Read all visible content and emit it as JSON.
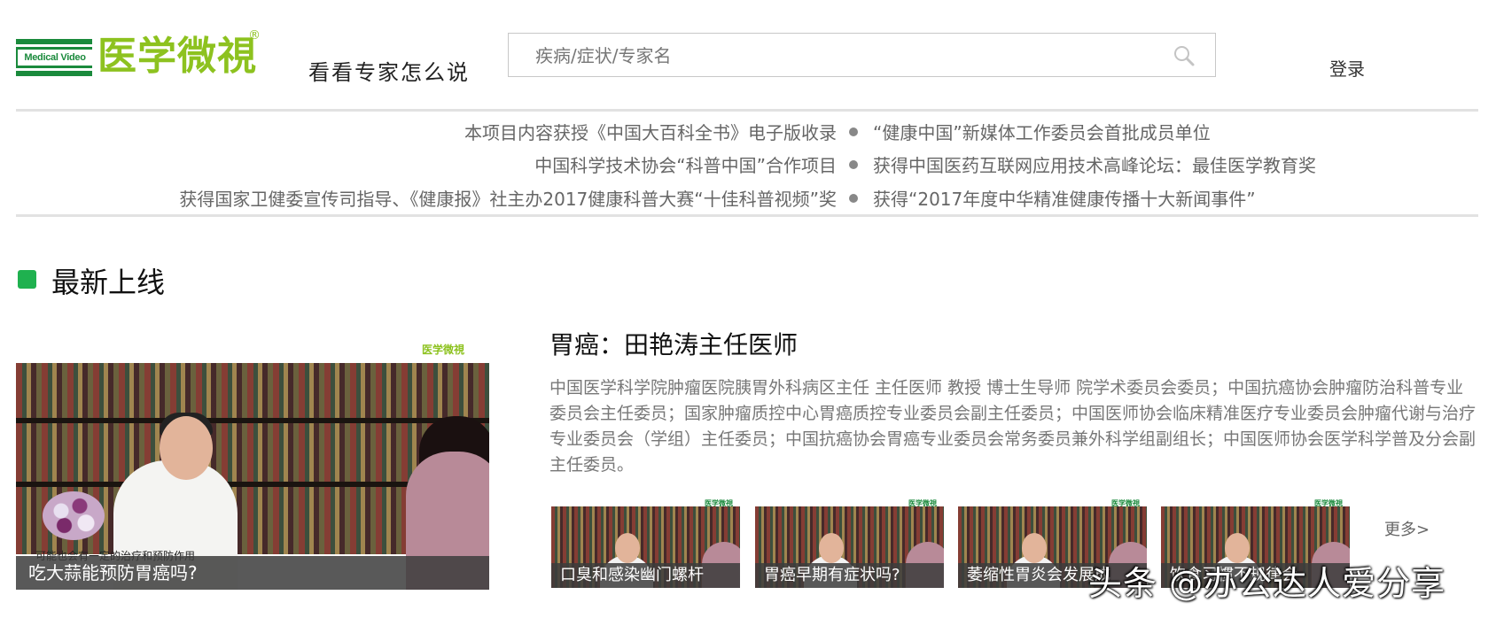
{
  "header": {
    "logo_en": "Medical Video",
    "logo_cn": "医学微視",
    "logo_reg": "®",
    "slogan": "看看专家怎么说",
    "search_placeholder": "疾病/症状/专家名",
    "login_label": "登录"
  },
  "honors": [
    {
      "left": "本项目内容获授《中国大百科全书》电子版收录",
      "right": "“健康中国”新媒体工作委员会首批成员单位"
    },
    {
      "left": "中国科学技术协会“科普中国”合作项目",
      "right": "获得中国医药互联网应用技术高峰论坛：最佳医学教育奖"
    },
    {
      "left": "获得国家卫健委宣传司指导、《健康报》社主办2017健康科普大赛“十佳科普视频”奖",
      "right": "获得“2017年度中华精准健康传播十大新闻事件”"
    }
  ],
  "section": {
    "title": "最新上线"
  },
  "main_video": {
    "watermark": "医学微視",
    "subtitle_strip": "可能也会有一定的治疗和预防作用",
    "caption": "吃大蒜能预防胃癌吗?"
  },
  "expert": {
    "title": "胃癌：田艳涛主任医师",
    "description": "中国医学科学院肿瘤医院胰胃外科病区主任 主任医师 教授 博士生导师 院学术委员会委员；中国抗癌协会肿瘤防治科普专业委员会主任委员；国家肿瘤质控中心胃癌质控专业委员会副主任委员；中国医师协会临床精准医疗专业委员会肿瘤代谢与治疗专业委员会（学组）主任委员；中国抗癌协会胃癌专业委员会常务委员兼外科学组副组长；中国医师协会医学科学普及分会副主任委员。"
  },
  "thumbs": [
    {
      "caption": "口臭和感染幽门螺杆",
      "wm": "医学微視"
    },
    {
      "caption": "胃癌早期有症状吗?",
      "wm": "医学微視"
    },
    {
      "caption": "萎缩性胃炎会发展成",
      "wm": "医学微視"
    },
    {
      "caption": "饮食习惯不规律会",
      "wm": "医学微視"
    }
  ],
  "more_label": "更多>",
  "overlay_watermark": "头条 @办公达人爱分享"
}
